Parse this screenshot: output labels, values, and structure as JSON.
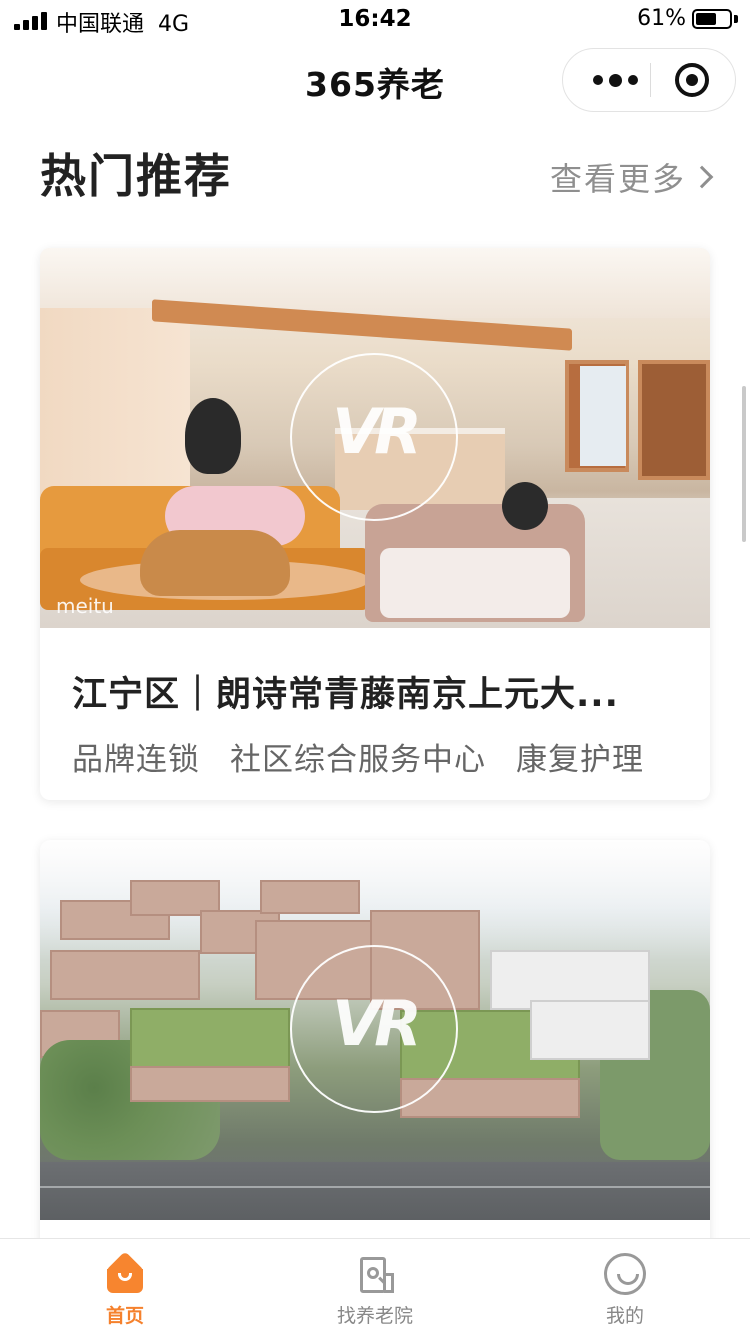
{
  "status_bar": {
    "carrier": "中国联通",
    "network": "4G",
    "time": "16:42",
    "battery_percent": "61%",
    "battery_level": 0.61,
    "signal_bars": 4
  },
  "nav": {
    "title": "365养老",
    "more_icon": "more-dots-icon",
    "close_icon": "target-close-icon"
  },
  "section": {
    "title": "热门推荐",
    "see_more_label": "查看更多"
  },
  "cards": [
    {
      "image_desc_icon": "vr-badge-icon",
      "vr_label": "VR",
      "watermark": "meitu",
      "title": "江宁区｜朗诗常青藤南京上元大...",
      "tags": [
        "品牌连锁",
        "社区综合服务中心",
        "康复护理"
      ]
    },
    {
      "image_desc_icon": "vr-badge-icon",
      "vr_label": "VR"
    }
  ],
  "tabbar": {
    "items": [
      {
        "label": "首页",
        "icon": "home-icon",
        "active": true
      },
      {
        "label": "找养老院",
        "icon": "building-search-icon",
        "active": false
      },
      {
        "label": "我的",
        "icon": "smile-face-icon",
        "active": false
      }
    ]
  },
  "colors": {
    "accent": "#f5812d",
    "text_primary": "#222222",
    "text_secondary": "#666666",
    "text_muted": "#8f8f8f"
  }
}
